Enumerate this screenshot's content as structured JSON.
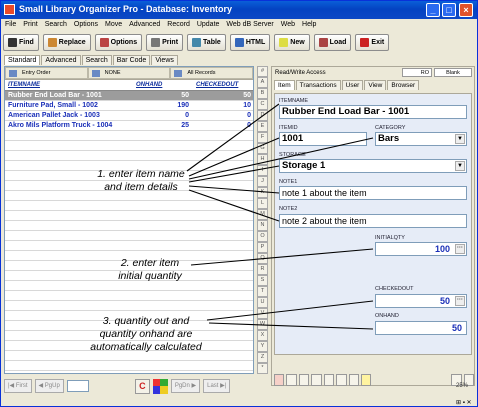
{
  "window": {
    "title": "Small Library Organizer Pro - Database: Inventory"
  },
  "menu": [
    "File",
    "Print",
    "Search",
    "Options",
    "Move",
    "Advanced",
    "Record",
    "Update",
    "Web dB Server",
    "Web",
    "Help"
  ],
  "toolbar": {
    "find": "Find",
    "replace": "Replace",
    "options": "Options",
    "print": "Print",
    "table": "Table",
    "html": "HTML",
    "new": "New",
    "load": "Load",
    "exit": "Exit"
  },
  "main_tabs": [
    "Standard",
    "Advanced",
    "Search",
    "Bar Code",
    "Views"
  ],
  "sort_bar": {
    "entry_order": "Entry Order",
    "none": "NONE",
    "all_records": "All Records"
  },
  "grid": {
    "columns": [
      "ITEMNAME",
      "ONHAND",
      "CHECKEDOUT"
    ],
    "rows": [
      [
        "Rubber End Load Bar - 1001",
        "50",
        "50"
      ],
      [
        "Furniture Pad, Small - 1002",
        "190",
        "10"
      ],
      [
        "American Pallet Jack - 1003",
        "0",
        "0"
      ],
      [
        "Akro Mils Platform Truck - 1004",
        "25",
        "0"
      ]
    ]
  },
  "nav": {
    "first": "First",
    "pgup": "PgUp",
    "pgdn": "PgDn",
    "last": "Last"
  },
  "alphabet": [
    "#",
    "A",
    "B",
    "C",
    "D",
    "E",
    "F",
    "G",
    "H",
    "I",
    "J",
    "K",
    "L",
    "M",
    "N",
    "O",
    "P",
    "Q",
    "R",
    "S",
    "T",
    "U",
    "V",
    "W",
    "X",
    "Y",
    "Z",
    "*"
  ],
  "right": {
    "access": "Read/Write Access",
    "ro": "RO",
    "blank": "Blank",
    "tabs": [
      "Item",
      "Transactions",
      "User",
      "View",
      "Browser"
    ],
    "labels": {
      "itemname": "ITEMNAME",
      "itemid": "ITEMID",
      "category": "CATEGORY",
      "storage": "STORAGE",
      "note1": "NOTE1",
      "note2": "NOTE2",
      "initialqty": "INITIALQTY",
      "checkedout": "CHECKEDOUT",
      "onhand": "ONHAND"
    },
    "values": {
      "itemname": "Rubber End Load Bar - 1001",
      "itemid": "1001",
      "category": "Bars",
      "storage": "Storage 1",
      "note1": "note 1 about the item",
      "note2": "note 2 about the item",
      "initialqty": "100",
      "checkedout": "50",
      "onhand": "50"
    }
  },
  "zoom": "25%",
  "annotations": {
    "a1_line1": "1. enter item name",
    "a1_line2": "and item details",
    "a2_line1": "2. enter item",
    "a2_line2": "initial quantity",
    "a3_line1": "3. quantity out and",
    "a3_line2": "quantity onhand are",
    "a3_line3": "automatically calculated"
  }
}
